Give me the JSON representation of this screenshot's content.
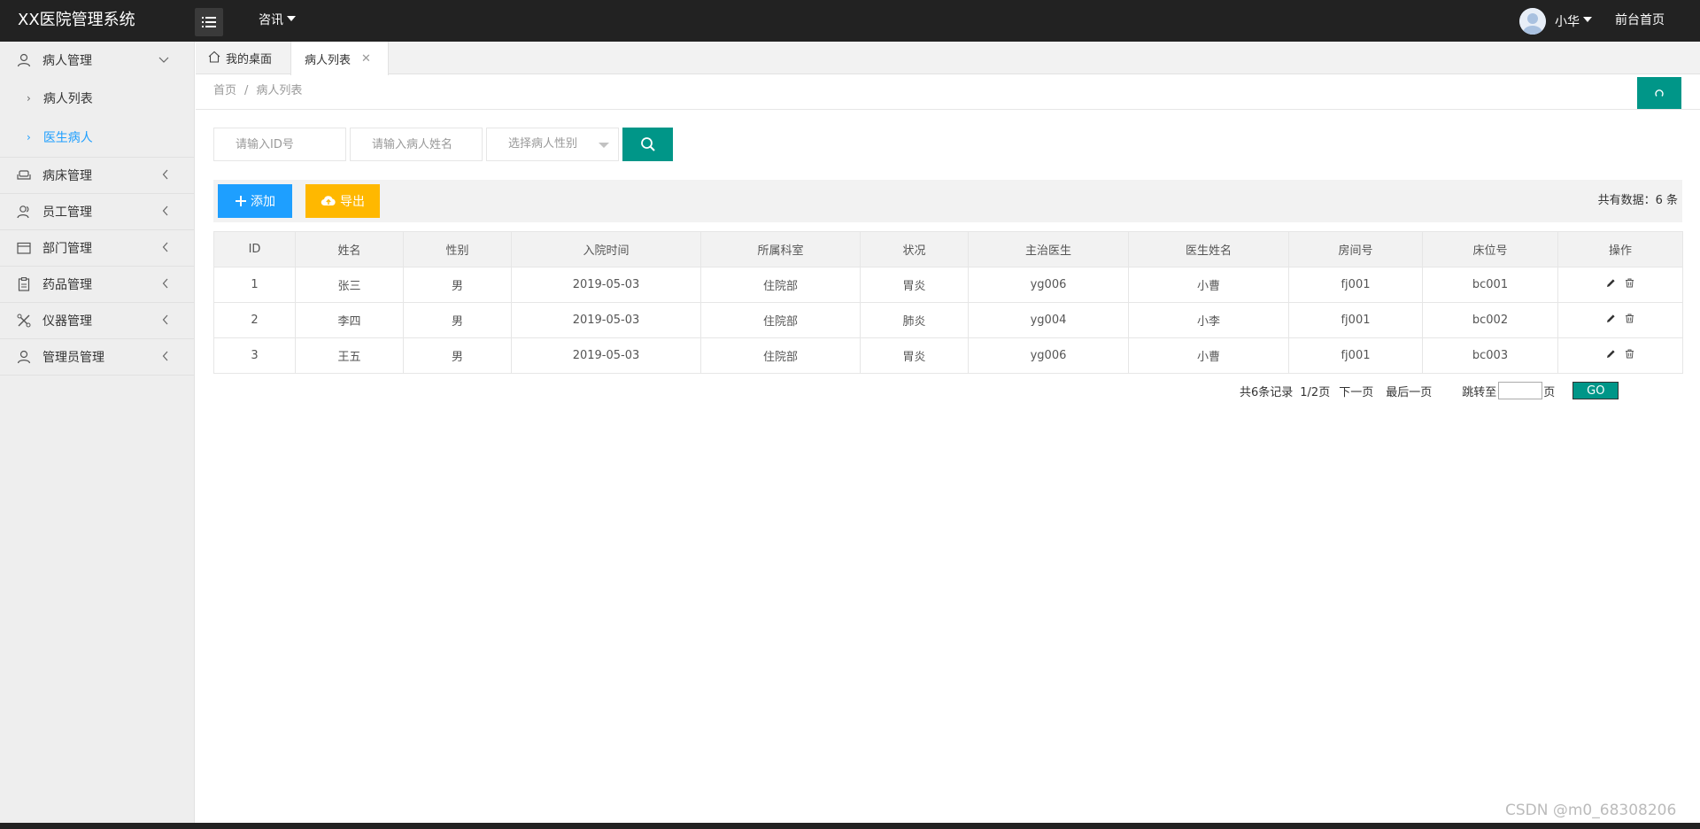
{
  "header": {
    "title": "XX医院管理系统",
    "nav_label": "咨讯",
    "user_name": "小华",
    "front_link": "前台首页"
  },
  "sidebar": {
    "groups": [
      {
        "label": "病人管理",
        "icon": "user-icon",
        "expanded": true,
        "items": [
          {
            "label": "病人列表"
          },
          {
            "label": "医生病人",
            "active": true
          }
        ]
      },
      {
        "label": "病床管理",
        "icon": "sofa-icon"
      },
      {
        "label": "员工管理",
        "icon": "users-icon"
      },
      {
        "label": "部门管理",
        "icon": "calendar-icon"
      },
      {
        "label": "药品管理",
        "icon": "clipboard-icon"
      },
      {
        "label": "仪器管理",
        "icon": "tools-icon"
      },
      {
        "label": "管理员管理",
        "icon": "admin-icon"
      }
    ]
  },
  "tabs": {
    "home": "我的桌面",
    "active": "病人列表"
  },
  "breadcrumb": {
    "home": "首页",
    "sep": "/",
    "current": "病人列表"
  },
  "search": {
    "id_placeholder": "请输入ID号",
    "name_placeholder": "请输入病人姓名",
    "sex_select": "选择病人性别"
  },
  "toolbar": {
    "add_label": "添加",
    "export_label": "导出",
    "total_text": "共有数据：6 条"
  },
  "table": {
    "columns": [
      "ID",
      "姓名",
      "性别",
      "入院时间",
      "所属科室",
      "状况",
      "主治医生",
      "医生姓名",
      "房间号",
      "床位号",
      "操作"
    ],
    "rows": [
      [
        "1",
        "张三",
        "男",
        "2019-05-03",
        "住院部",
        "胃炎",
        "yg006",
        "小曹",
        "fj001",
        "bc001"
      ],
      [
        "2",
        "李四",
        "男",
        "2019-05-03",
        "住院部",
        "肺炎",
        "yg004",
        "小李",
        "fj001",
        "bc002"
      ],
      [
        "3",
        "王五",
        "男",
        "2019-05-03",
        "住院部",
        "胃炎",
        "yg006",
        "小曹",
        "fj001",
        "bc003"
      ]
    ]
  },
  "pager": {
    "records": "共6条记录",
    "page": "1/2页",
    "next": "下一页",
    "last": "最后一页",
    "jump": "跳转至",
    "page_unit": "页",
    "go": "GO"
  },
  "watermark": "CSDN @m0_68308206",
  "colors": {
    "header_bg": "#222222",
    "primary_teal": "#009688",
    "add_blue": "#1E9FFF",
    "export_yellow": "#FFB800",
    "active_link": "#1E9FFF"
  }
}
